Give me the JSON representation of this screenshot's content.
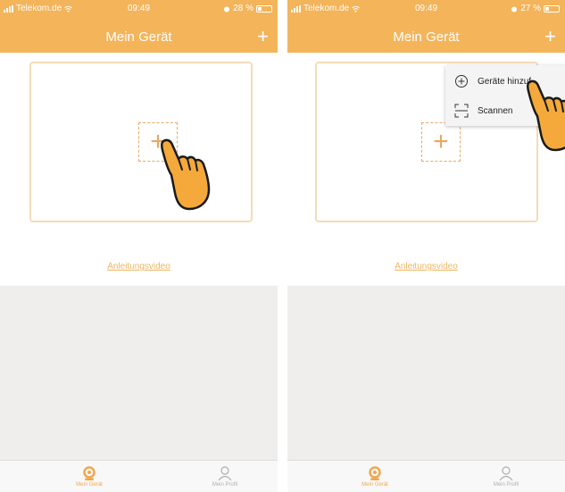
{
  "colors": {
    "accent": "#f4b45a",
    "accent_dark": "#e9a760",
    "gray_area": "#efeeed",
    "link": "#f0b560"
  },
  "left_screen": {
    "status": {
      "carrier": "Telekom.de",
      "time": "09:49",
      "battery": "28 %"
    },
    "title": "Mein Gerät",
    "top_right_icon": "plus-icon",
    "add_device_icon": "plus-icon",
    "tutorial_link": "Anleitungsvideo",
    "tabs": [
      {
        "label": "Mein Gerät",
        "icon": "device-icon",
        "active": true
      },
      {
        "label": "Mein Profil",
        "icon": "profile-icon",
        "active": false
      }
    ]
  },
  "right_screen": {
    "status": {
      "carrier": "Telekom.de",
      "time": "09:49",
      "battery": "27 %"
    },
    "title": "Mein Gerät",
    "top_right_icon": "plus-icon",
    "add_device_icon": "plus-icon",
    "tutorial_link": "Anleitungsvideo",
    "menu": [
      {
        "label": "Geräte hinzuf...",
        "icon": "circle-plus-icon"
      },
      {
        "label": "Scannen",
        "icon": "scan-icon"
      }
    ],
    "tabs": [
      {
        "label": "Mein Gerät",
        "icon": "device-icon",
        "active": true
      },
      {
        "label": "Mein Profil",
        "icon": "profile-icon",
        "active": false
      }
    ]
  }
}
